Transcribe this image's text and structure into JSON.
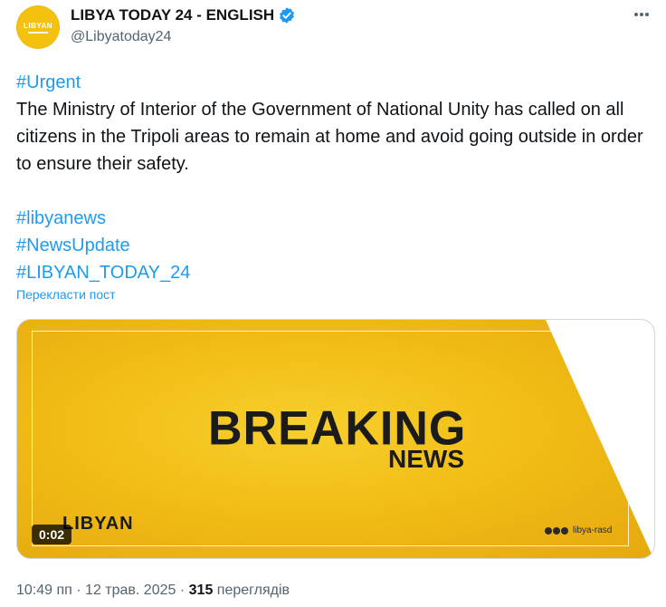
{
  "account": {
    "display_name": "LIBYA TODAY 24 - ENGLISH",
    "handle": "@Libyatoday24",
    "avatar_text": "LIBYAN",
    "verified": true
  },
  "tweet": {
    "hashtag_urgent": "#Urgent",
    "body": "The Ministry of Interior of the Government of National Unity has called on all citizens in the Tripoli areas to remain at home and avoid going outside in order to ensure their safety.",
    "hashtags": [
      "#libyanews",
      "#NewsUpdate",
      "#LIBYAN_TODAY_24"
    ],
    "translate_label": "Перекласти пост"
  },
  "media": {
    "headline_big": "BREAKING",
    "headline_small": "NEWS",
    "watermark_left": "LIBYAN",
    "watermark_right": "libya-rasd",
    "duration": "0:02"
  },
  "meta": {
    "time": "10:49 пп",
    "date": "12 трав. 2025",
    "views_count": "315",
    "views_label": "переглядів"
  },
  "colors": {
    "accent": "#1d9bf0",
    "text": "#0f1419",
    "muted": "#536471",
    "media_yellow": "#f2bd16"
  },
  "icons": [
    "verified-badge-icon",
    "more-options-icon"
  ]
}
